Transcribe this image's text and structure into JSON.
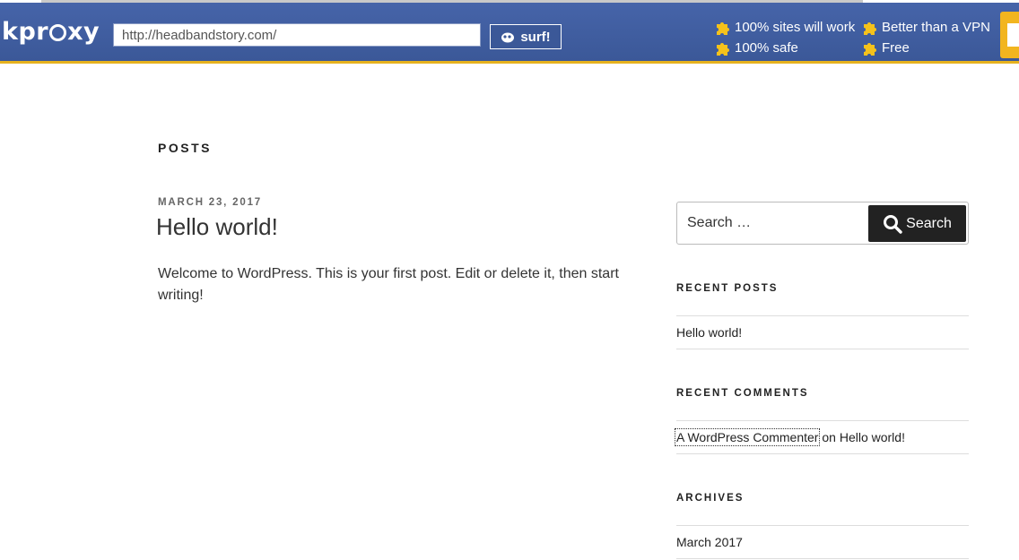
{
  "proxy": {
    "logo_start": "kpr",
    "logo_end": "xy",
    "url_value": "http://headbandstory.com/",
    "surf_label": "surf!",
    "features": [
      "100% sites will work",
      "100% safe",
      "Better than a VPN",
      "Free"
    ],
    "accent_color": "#e6b21e",
    "bar_color": "#3f5da1"
  },
  "content": {
    "posts_heading": "POSTS",
    "post": {
      "date": "MARCH 23, 2017",
      "title": "Hello world!",
      "body": "Welcome to WordPress. This is your first post. Edit or delete it, then start writing!"
    }
  },
  "sidebar": {
    "search": {
      "placeholder": "Search …",
      "button_label": "Search"
    },
    "recent_posts": {
      "title": "RECENT POSTS",
      "items": [
        "Hello world!"
      ]
    },
    "recent_comments": {
      "title": "RECENT COMMENTS",
      "author": "A WordPress Commenter",
      "connector": " on ",
      "post": "Hello world!"
    },
    "archives": {
      "title": "ARCHIVES",
      "items": [
        "March 2017"
      ]
    }
  }
}
